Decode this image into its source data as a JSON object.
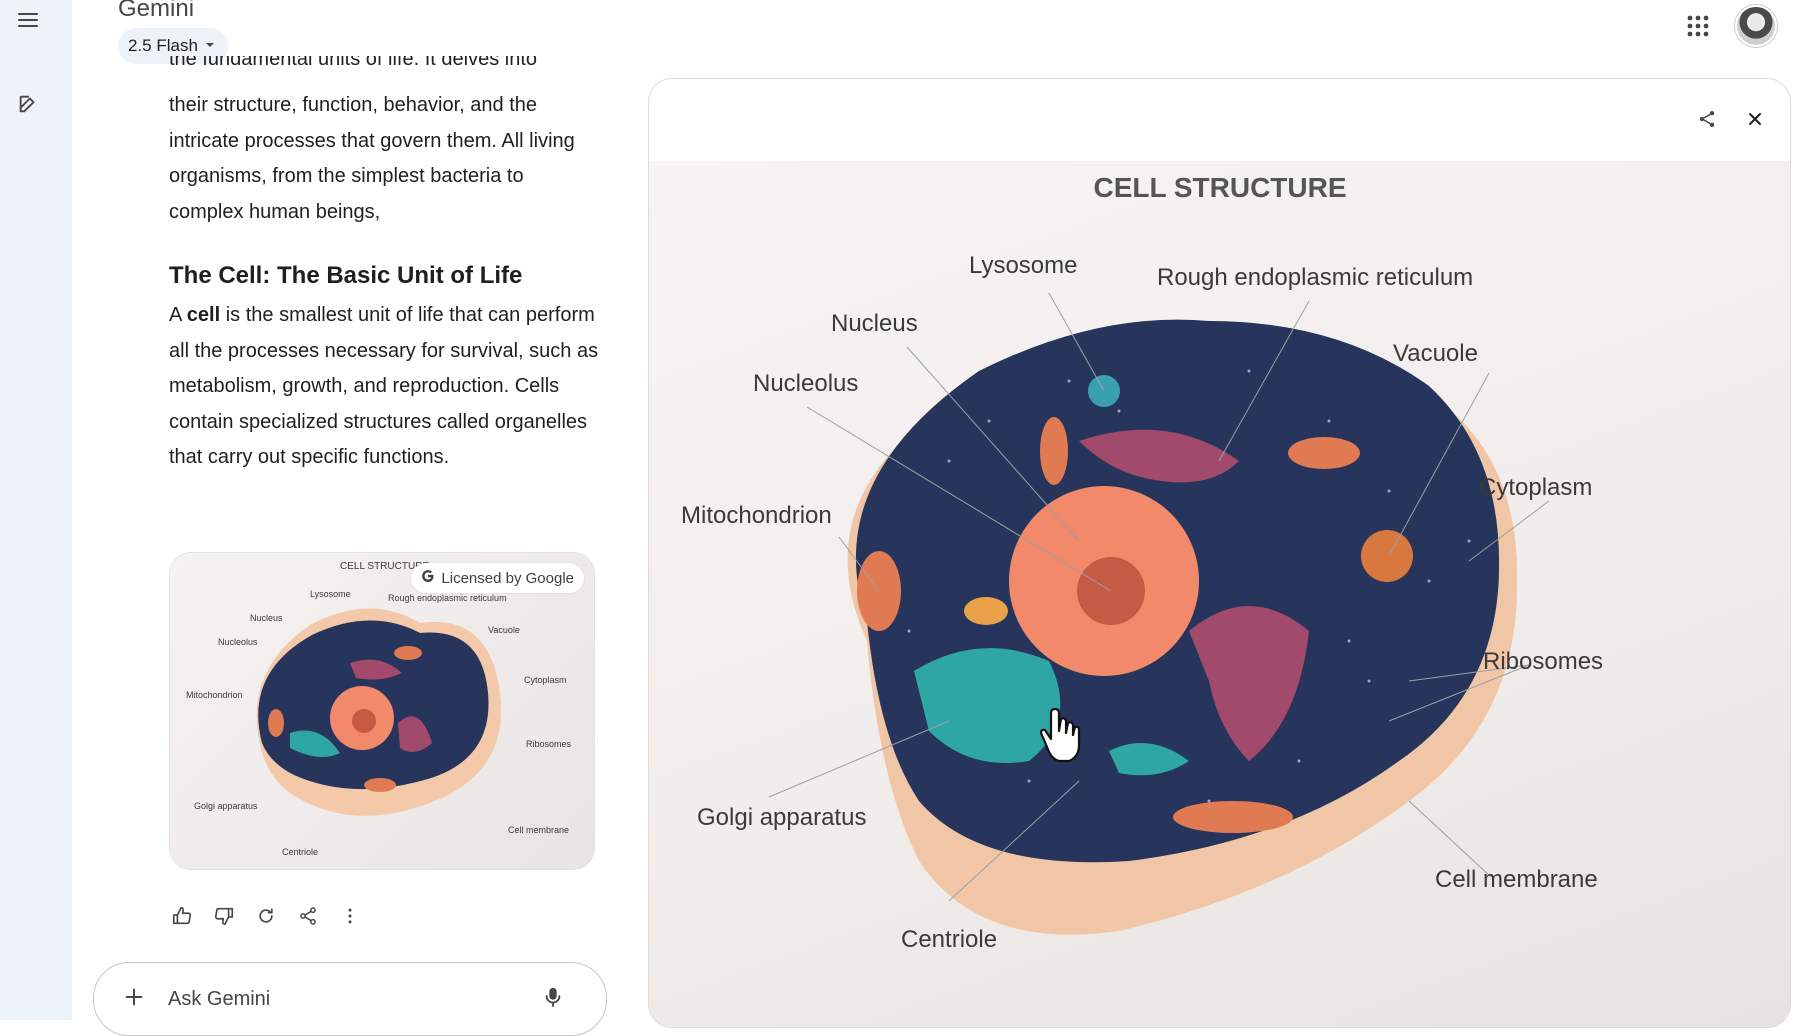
{
  "app": {
    "title": "Gemini",
    "model": "2.5 Flash"
  },
  "chat": {
    "clipped_line": "the fundamental units of life. It delves into",
    "paragraph_1": "their structure, function, behavior, and the intricate processes that govern them. All living organisms, from the simplest bacteria to complex human beings,",
    "section_title": "The Cell: The Basic Unit of Life",
    "paragraph_2_prefix": "A ",
    "paragraph_2_bold": "cell",
    "paragraph_2_rest": " is the smallest unit of life that can perform all the processes necessary for survival, such as metabolism, growth, and reproduction. Cells contain specialized structures called organelles that carry out specific functions.",
    "license_badge": "Licensed by Google",
    "thumbnail_labels": [
      "CELL STRUCTURE",
      "Lysosome",
      "Rough endoplasmic reticulum",
      "Nucleus",
      "Vacuole",
      "Nucleolus",
      "Cytoplasm",
      "Mitochondrion",
      "Ribosomes",
      "Golgi apparatus",
      "Cell membrane",
      "Centriole"
    ]
  },
  "input": {
    "placeholder": "Ask Gemini"
  },
  "figure": {
    "title": "CELL STRUCTURE",
    "labels": {
      "lysosome": "Lysosome",
      "rough_er": "Rough endoplasmic reticulum",
      "nucleus": "Nucleus",
      "vacuole": "Vacuole",
      "nucleolus": "Nucleolus",
      "cytoplasm": "Cytoplasm",
      "mitochondrion": "Mitochondrion",
      "ribosomes": "Ribosomes",
      "golgi": "Golgi apparatus",
      "cell_membrane": "Cell membrane",
      "centriole": "Centriole"
    }
  },
  "colors": {
    "rail_bg": "#eef2f9",
    "cell_cytoplasm": "#26335a",
    "cell_wall": "#f2c6a6",
    "nucleus": "#f08a64",
    "golgi": "#2fa6a6",
    "er": "#a04a6a"
  }
}
